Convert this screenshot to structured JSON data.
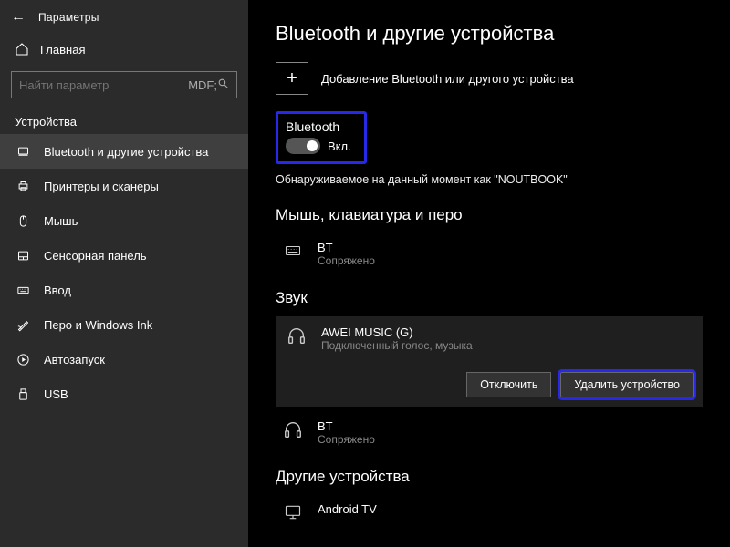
{
  "header": {
    "app_title": "Параметры",
    "home_label": "Главная",
    "search_placeholder": "Найти параметр"
  },
  "sidebar": {
    "section_label": "Устройства",
    "items": [
      {
        "label": "Bluetooth и другие устройства"
      },
      {
        "label": "Принтеры и сканеры"
      },
      {
        "label": "Мышь"
      },
      {
        "label": "Сенсорная панель"
      },
      {
        "label": "Ввод"
      },
      {
        "label": "Перо и Windows Ink"
      },
      {
        "label": "Автозапуск"
      },
      {
        "label": "USB"
      }
    ]
  },
  "main": {
    "page_title": "Bluetooth и другие устройства",
    "add_device_label": "Добавление Bluetooth или другого устройства",
    "bt_heading": "Bluetooth",
    "toggle_state": "Вкл.",
    "discover_text": "Обнаруживаемое на данный момент как \"NOUTBOOK\"",
    "section_mouse": "Мышь, клавиатура и перо",
    "devices_mouse": [
      {
        "name": "BT",
        "status": "Сопряжено"
      }
    ],
    "section_sound": "Звук",
    "devices_sound": [
      {
        "name": "AWEI MUSIC (G)",
        "status": "Подключенный голос, музыка"
      },
      {
        "name": "BT",
        "status": "Сопряжено"
      }
    ],
    "btn_disconnect": "Отключить",
    "btn_remove": "Удалить устройство",
    "section_other": "Другие устройства",
    "devices_other": [
      {
        "name": "Android TV"
      }
    ]
  }
}
